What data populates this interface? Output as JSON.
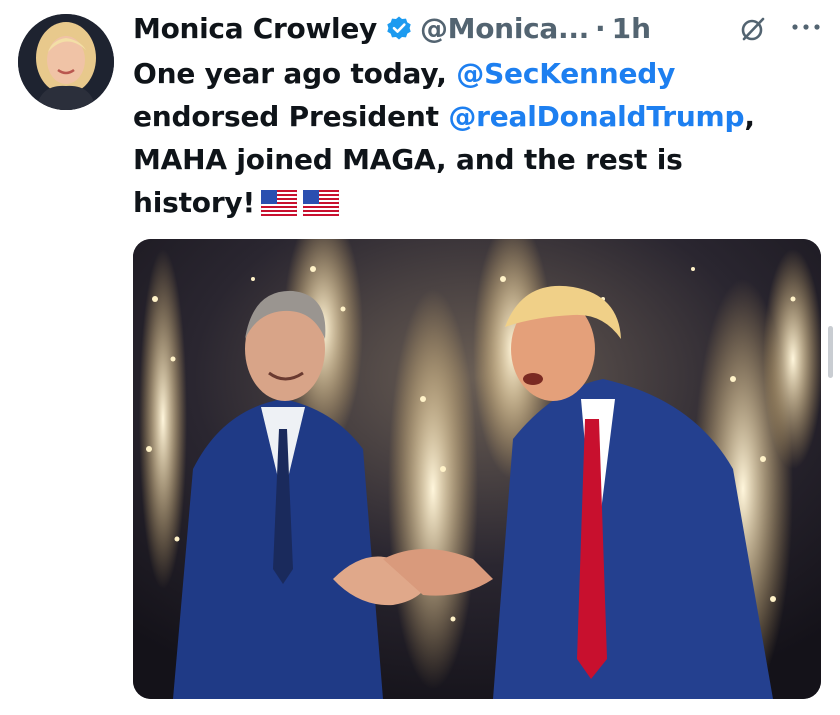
{
  "author": {
    "display_name": "Monica Crowley",
    "handle": "@Monica...",
    "separator": "·",
    "time": "1h",
    "verified_badge_color": "#1d9bf0"
  },
  "tweet": {
    "line1_prefix": "One year ago today, ",
    "mention_1": "@SecKennedy",
    "line2_prefix": "endorsed President ",
    "mention_2": "@realDonaldTrump",
    "line2_suffix": ",",
    "line3": "MAHA joined MAGA, and the rest is",
    "line4": "history!",
    "flags": [
      "us-flag-emoji",
      "us-flag-emoji"
    ],
    "mention_color": "#1d7ff0"
  },
  "icons": {
    "grok": "grok-slash-icon",
    "more": "more-ellipsis-icon",
    "verified": "verified-badge-icon"
  },
  "media": {
    "kind": "photo",
    "accent_suit": "#1f3a86",
    "accent_tie": "#c8102e"
  }
}
